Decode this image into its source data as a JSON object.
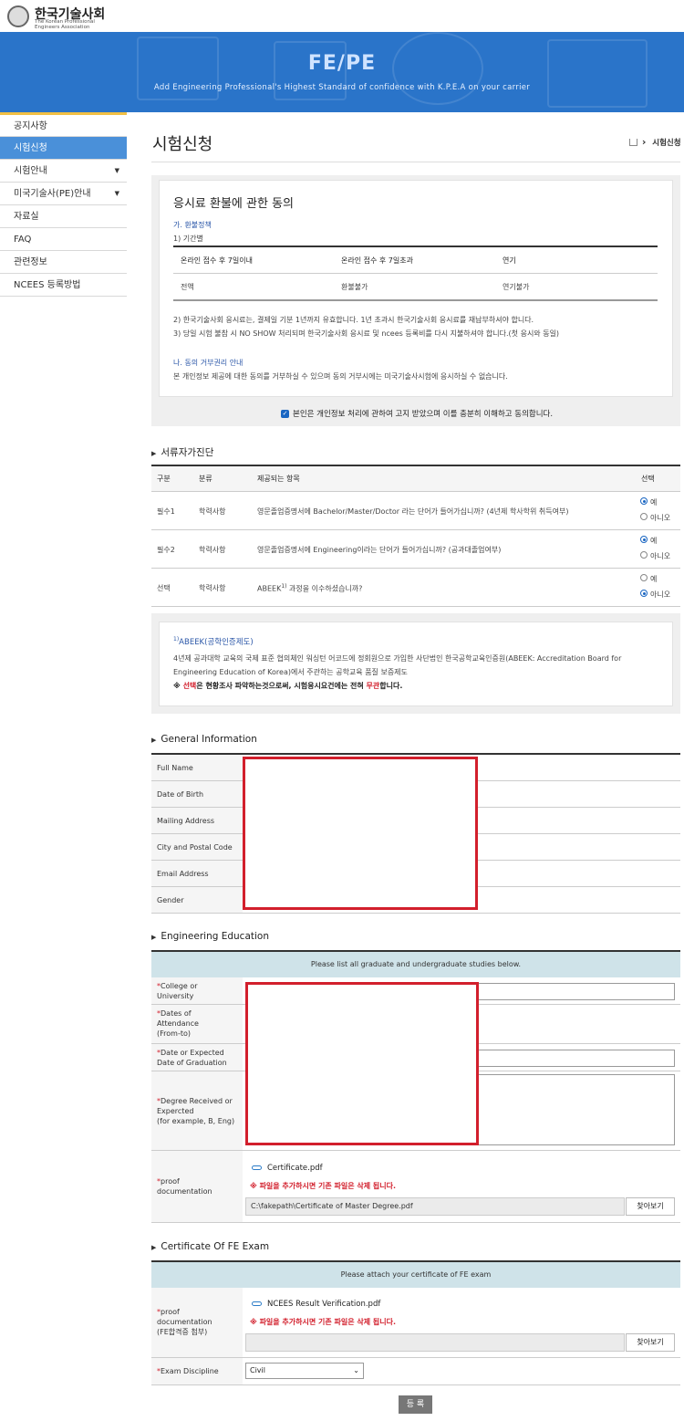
{
  "header": {
    "logo_title": "한국기술사회",
    "logo_sub": "The Korean Professional Engineers Association"
  },
  "banner": {
    "title": "FE/PE",
    "subtitle": "Add Engineering Professional's Highest Standard of confidence with K.P.E.A on your carrier"
  },
  "sidebar": {
    "items": [
      {
        "label": "공지사항",
        "active": false,
        "caret": false
      },
      {
        "label": "시험신청",
        "active": true,
        "caret": false
      },
      {
        "label": "시험안내",
        "active": false,
        "caret": true
      },
      {
        "label": "미국기술사(PE)안내",
        "active": false,
        "caret": true
      },
      {
        "label": "자료실",
        "active": false,
        "caret": false
      },
      {
        "label": "FAQ",
        "active": false,
        "caret": false
      },
      {
        "label": "관련정보",
        "active": false,
        "caret": false
      },
      {
        "label": "NCEES 등록방법",
        "active": false,
        "caret": false
      }
    ]
  },
  "page": {
    "title": "시험신청",
    "breadcrumb": "시험신청",
    "breadcrumb_sep": "›"
  },
  "consent": {
    "title": "응시료 환불에 관한 동의",
    "section_a": "가. 환불정책",
    "sub_1": "1) 기간별",
    "table_headers": [
      "온라인 접수 후 7일이내",
      "온라인 접수 후 7일초과",
      "연기"
    ],
    "table_values": [
      "전액",
      "환불불가",
      "연기불가"
    ],
    "note_2": "2) 한국기술사회 응시료는, 결제일 기분 1년까지 유효합니다. 1년 초과시 한국기술사회 응시료를 재납부하셔야 합니다.",
    "note_3": "3) 당일 시험 불참 시 NO SHOW 처리되며 한국기술사회 응시료 및 ncees 등록비를 다시 지불하셔야 합니다.(첫 응시와 동일)",
    "section_b": "나. 동의 거부권리 안내",
    "section_b_text": "본 개인정보 제공에 대한 동의를 거부하실 수 있으며 동의 거부시에는 미국기술사시험에 응시하실 수 없습니다.",
    "agree_text": "본인은 개인정보 처리에 관하여 고지 받았으며 이를 충분히 이해하고 동의합니다.",
    "agree_checked": true
  },
  "self_check": {
    "heading": "서류자가진단",
    "headers": [
      "구분",
      "분류",
      "제공되는 항목",
      "선택"
    ],
    "yes_label": "예",
    "no_label": "아니오",
    "rows": [
      {
        "type": "필수1",
        "category": "학력사항",
        "item": "영문졸업증명서에 Bachelor/Master/Doctor 라는 단어가 들어가십니까? (4년제 학사학위 취득여부)",
        "selected": "yes"
      },
      {
        "type": "필수2",
        "category": "학력사항",
        "item": "영문졸업증명서에 Engineering이라는 단어가 들어가십니까? (공과대졸업여부)",
        "selected": "yes"
      },
      {
        "type": "선택",
        "category": "학력사항",
        "item": "ABEEK",
        "item_sup": "1)",
        "item_tail": " 과정을 이수하셨습니까?",
        "selected": "no"
      }
    ]
  },
  "abeek_note": {
    "sup": "1)",
    "title": "ABEEK(공학인증제도)",
    "line1": "4년제 공과대학 교육의 국제 표준 협의체인 워싱턴 어코드에 정회원으로 가입한 사단법인 한국공학교육인증원(ABEEK: Accreditation Board for",
    "line2": "Engineering Education of Korea)에서 주관하는 공학교육 품질 보증제도",
    "line3_prefix": "※ ",
    "line3_red1": "선택",
    "line3_mid": "은 현황조사 파악하는것으로써, 시험응시요건에는 전혀 ",
    "line3_red2": "무관",
    "line3_suffix": "합니다."
  },
  "general_info": {
    "heading": "General Information",
    "fields": [
      "Full Name",
      "Date of Birth",
      "Mailing Address",
      "City and Postal Code",
      "Email Address",
      "Gender"
    ]
  },
  "education": {
    "heading": "Engineering Education",
    "banner": "Please list all graduate and undergraduate studies below.",
    "college_l1": "College or",
    "college_l2": "University",
    "dates_l1": "Dates of",
    "dates_l2": "Attendance",
    "dates_l3": "(From-to)",
    "grad_l1": "Date or Expected",
    "grad_l2": "Date of Graduation",
    "degree_l1": "Degree Received or",
    "degree_l2": "Expercted",
    "degree_l3": "(for example, B, Eng)",
    "proof_l1": "proof",
    "proof_l2": "documentation",
    "existing_file": "Certificate.pdf",
    "warning": "※ 파일을 추가하시면 기존 파일은 삭제 됩니다.",
    "file_path": "C:\\fakepath\\Certificate of Master Degree.pdf",
    "find_button": "찾아보기"
  },
  "fe_exam": {
    "heading": "Certificate Of FE Exam",
    "banner": "Please attach your certificate of FE exam",
    "proof_l1": "proof",
    "proof_l2": "documentation",
    "proof_l3": "(FE합격증 첨부)",
    "existing_file": "NCEES Result Verification.pdf",
    "warning": "※ 파일을 추가하시면 기존 파일은 삭제 됩니다.",
    "file_path": "",
    "find_button": "찾아보기",
    "discipline_label": "Exam Discipline",
    "discipline_value": "Civil"
  },
  "submit_label": "등 록",
  "required_mark": "*",
  "colors": {
    "accent": "#2a74c9",
    "active": "#4a90d9",
    "required": "#d21f2c",
    "redact": "#d21f2c"
  }
}
